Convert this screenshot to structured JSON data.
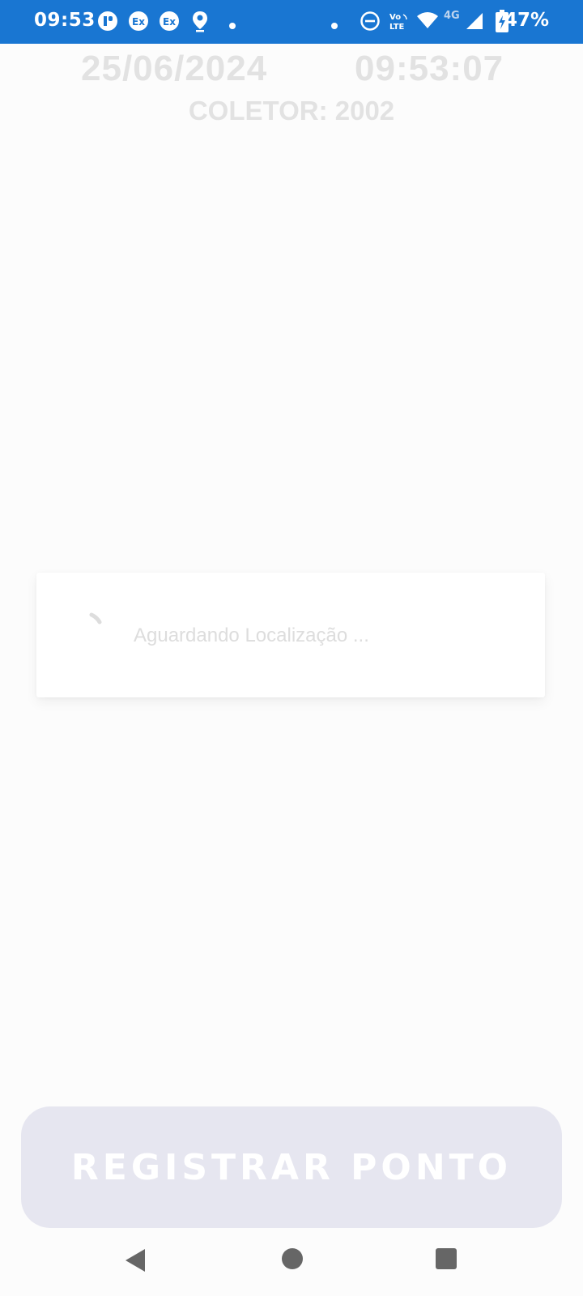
{
  "status_bar": {
    "time": "09:53",
    "battery": "47%",
    "bg_color": "#1976d2",
    "icons": [
      "notification-dot-icon",
      "exchange-icon",
      "exchange-icon",
      "location-pin-icon",
      "dot-icon",
      "dot-icon",
      "do-not-disturb-icon",
      "volte-icon",
      "wifi-icon",
      "signal-4g-icon",
      "battery-charging-icon"
    ],
    "network": "4G",
    "volte_line1": "Vo",
    "volte_line2": "LTE"
  },
  "header": {
    "date": "25/06/2024",
    "time": "09:53:07",
    "collector": "COLETOR: 2002"
  },
  "dialog": {
    "message": "Aguardando Localização ..."
  },
  "actions": {
    "register_label": "REGISTRAR PONTO",
    "button_color": "#e6e6f0"
  },
  "nav": {
    "icons": [
      "back-icon",
      "home-icon",
      "recents-icon"
    ]
  }
}
